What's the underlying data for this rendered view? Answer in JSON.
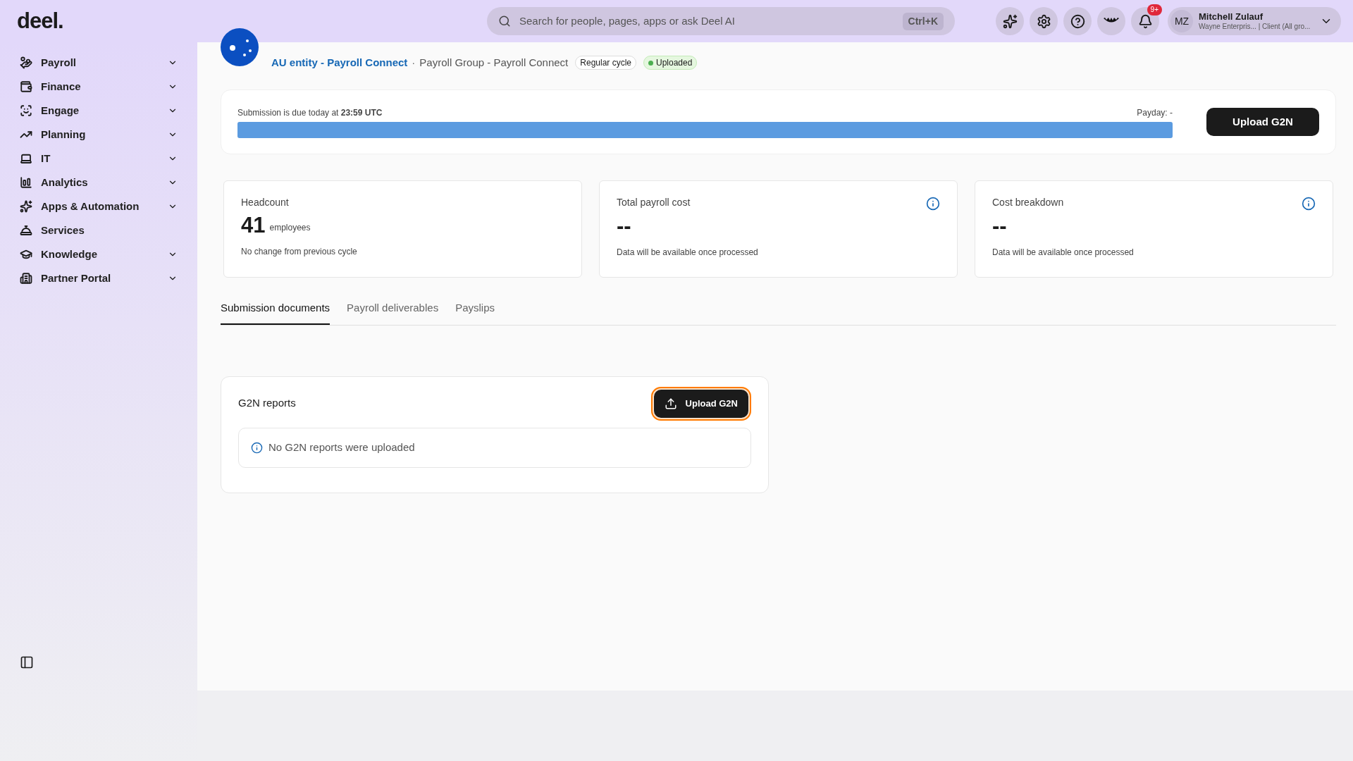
{
  "logo": "deel.",
  "search": {
    "placeholder": "Search for people, pages, apps or ask Deel AI",
    "shortcut": "Ctrl+K"
  },
  "notifications": {
    "badge": "9+"
  },
  "user": {
    "initials": "MZ",
    "name": "Mitchell Zulauf",
    "subtitle": "Wayne Enterpris... | Client (All gro..."
  },
  "sidebar": {
    "items": [
      {
        "label": "Payroll",
        "expandable": true
      },
      {
        "label": "Finance",
        "expandable": true
      },
      {
        "label": "Engage",
        "expandable": true
      },
      {
        "label": "Planning",
        "expandable": true
      },
      {
        "label": "IT",
        "expandable": true
      },
      {
        "label": "Analytics",
        "expandable": true
      },
      {
        "label": "Apps & Automation",
        "expandable": true
      },
      {
        "label": "Services",
        "expandable": false
      },
      {
        "label": "Knowledge",
        "expandable": true
      },
      {
        "label": "Partner Portal",
        "expandable": true
      }
    ]
  },
  "header": {
    "entity_link": "AU entity - Payroll Connect",
    "separator": "·",
    "group": "Payroll Group - Payroll Connect",
    "tags": [
      {
        "label": "Regular cycle",
        "kind": "plain"
      },
      {
        "label": "Uploaded",
        "kind": "status"
      }
    ]
  },
  "submission": {
    "due_text": "Submission is due today at **23:59 UTC**",
    "payday": "Payday: -",
    "level": 1,
    "button": "Upload G2N"
  },
  "stats": [
    {
      "title": "Headcount",
      "value": "41",
      "unit": "employees",
      "note": "No change from previous cycle",
      "info": false
    },
    {
      "title": "Total payroll cost",
      "value": "--",
      "note": "Data will be available once processed",
      "info": true
    },
    {
      "title": "Cost breakdown",
      "value": "--",
      "note": "Data will be available once processed",
      "info": true
    }
  ],
  "tabs": [
    {
      "label": "Submission documents",
      "selected": true
    },
    {
      "label": "Payroll deliverables",
      "selected": false
    },
    {
      "label": "Payslips",
      "selected": false
    }
  ],
  "g2n": {
    "title": "G2N reports",
    "button": "Upload G2N",
    "highlighted": true,
    "empty_message": "No G2N reports were uploaded"
  }
}
